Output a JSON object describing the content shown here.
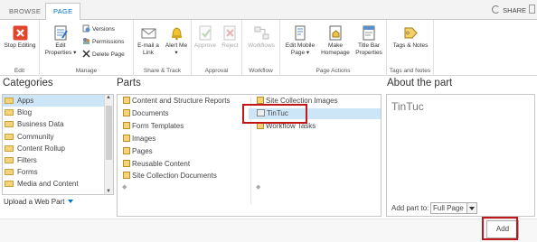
{
  "tabs": {
    "browse": "BROWSE",
    "page": "PAGE",
    "share": "SHARE"
  },
  "ribbon": {
    "edit": {
      "label": "Edit",
      "stop_editing": "Stop Editing"
    },
    "manage": {
      "label": "Manage",
      "edit_properties": "Edit Properties ▾",
      "versions": "Versions",
      "permissions": "Permissions",
      "delete_page": "Delete Page"
    },
    "share_track": {
      "label": "Share & Track",
      "email_link": "E-mail a Link",
      "alert_me": "Alert Me ▾"
    },
    "approval": {
      "label": "Approval",
      "approve": "Approve",
      "reject": "Reject"
    },
    "workflow": {
      "label": "Workflow",
      "workflows": "Workflows"
    },
    "page_actions": {
      "label": "Page Actions",
      "edit_mobile_page": "Edit Mobile Page ▾",
      "make_homepage": "Make Homepage",
      "title_bar_properties": "Title Bar Properties"
    },
    "tags_notes": {
      "label": "Tags and Notes",
      "tags_notes_btn": "Tags & Notes"
    }
  },
  "categories": {
    "heading": "Categories",
    "items": [
      "Apps",
      "Blog",
      "Business Data",
      "Community",
      "Content Rollup",
      "Filters",
      "Forms",
      "Media and Content"
    ],
    "upload": "Upload a Web Part"
  },
  "parts": {
    "heading": "Parts",
    "col1": [
      "Content and Structure Reports",
      "Documents",
      "Form Templates",
      "Images",
      "Pages",
      "Reusable Content",
      "Site Collection Documents"
    ],
    "col2": [
      "Site Collection Images",
      "TinTuc",
      "Workflow Tasks"
    ]
  },
  "about": {
    "heading": "About the part",
    "title": "TinTuc",
    "add_part_to": "Add part to:",
    "zone": "Full Page"
  },
  "footer": {
    "add": "Add"
  },
  "colors": {
    "accent": "#0072c6",
    "selection": "#cde6f7",
    "highlight": "#c0171b"
  }
}
